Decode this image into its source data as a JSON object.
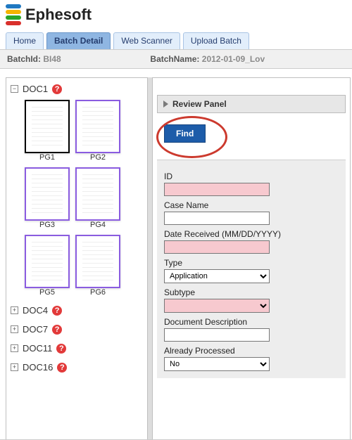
{
  "header": {
    "app_name": "Ephesoft"
  },
  "tabs": [
    {
      "label": "Home",
      "active": false
    },
    {
      "label": "Batch Detail",
      "active": true
    },
    {
      "label": "Web Scanner",
      "active": false
    },
    {
      "label": "Upload Batch",
      "active": false
    }
  ],
  "batchbar": {
    "id_label": "BatchId: ",
    "id_value": "BI48",
    "name_label": "BatchName: ",
    "name_value": "2012-01-09_Lov"
  },
  "docs": [
    {
      "label": "DOC1",
      "expanded": true,
      "pages": [
        "PG1",
        "PG2",
        "PG3",
        "PG4",
        "PG5",
        "PG6"
      ]
    },
    {
      "label": "DOC4",
      "expanded": false
    },
    {
      "label": "DOC7",
      "expanded": false
    },
    {
      "label": "DOC11",
      "expanded": false
    },
    {
      "label": "DOC16",
      "expanded": false
    }
  ],
  "review": {
    "title": "Review Panel",
    "find_label": "Find"
  },
  "form": {
    "id": {
      "label": "ID",
      "value": "",
      "error": true
    },
    "case_name": {
      "label": "Case Name",
      "value": "",
      "error": false
    },
    "date_received": {
      "label": "Date Received (MM/DD/YYYY)",
      "value": "",
      "error": true
    },
    "type": {
      "label": "Type",
      "value": "Application",
      "error": false
    },
    "subtype": {
      "label": "Subtype",
      "value": "",
      "error": true
    },
    "doc_desc": {
      "label": "Document Description",
      "value": "",
      "error": false
    },
    "already_processed": {
      "label": "Already Processed",
      "value": "No",
      "error": false
    }
  },
  "colors": {
    "tab_bg": "#e2eefb",
    "tab_active_bg": "#8fb6e2",
    "find_btn_bg": "#1d5ca9",
    "error_field_bg": "#f7c9cf",
    "thumb_border": "#8a5ce0",
    "annotation_circle": "#cc3a2e"
  }
}
